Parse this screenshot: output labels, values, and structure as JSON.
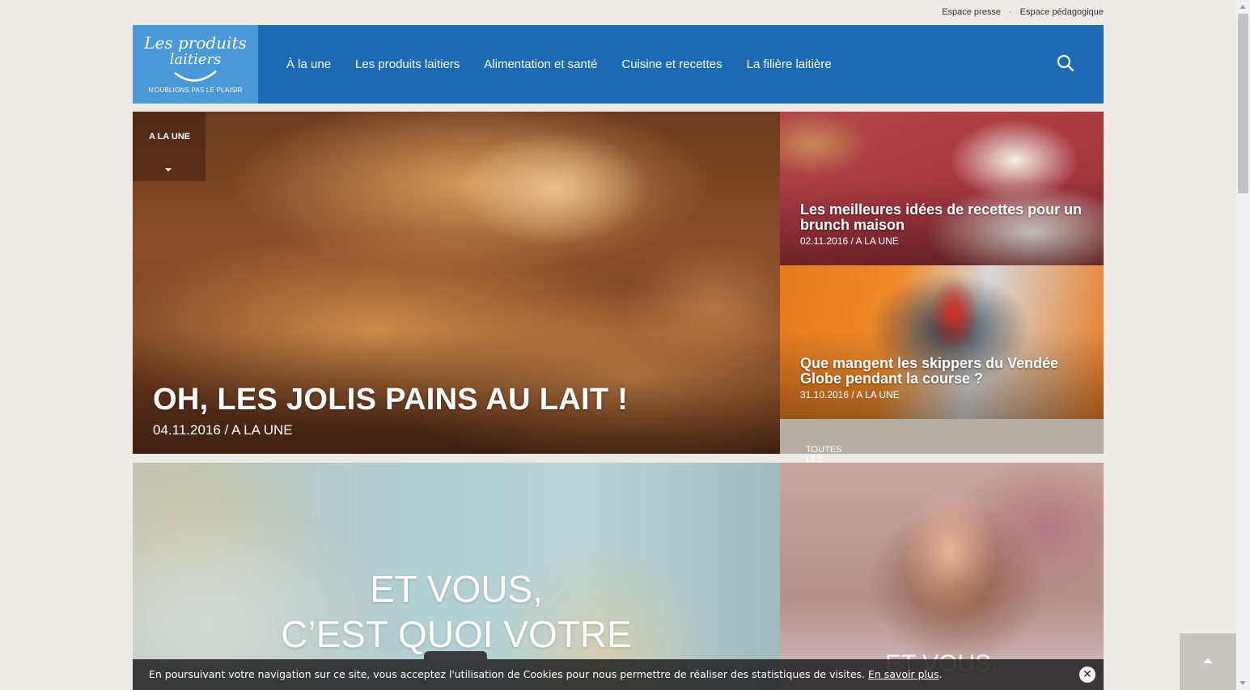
{
  "top_links": {
    "press": "Espace presse",
    "separator": "·",
    "education": "Espace pédagogique"
  },
  "logo": {
    "line1": "Les produits",
    "line2": "laitiers",
    "tagline": "N'OUBLIONS PAS LE PLAISIR"
  },
  "nav": {
    "items": [
      "À la une",
      "Les produits laitiers",
      "Alimentation et santé",
      "Cuisine et recettes",
      "La filière laitière"
    ],
    "search_icon": "search-icon"
  },
  "hero": {
    "badge": "A LA UNE",
    "title": "OH, LES JOLIS PAINS AU LAIT !",
    "meta": "04.11.2016 / A LA UNE"
  },
  "side_articles": [
    {
      "title": "Les meilleures idées de recettes pour un brunch maison",
      "meta": "02.11.2016 / A LA UNE"
    },
    {
      "title": "Que mangent les skippers du Vendée Globe pendant la course ?",
      "meta": "31.10.2016 / A LA UNE"
    }
  ],
  "all_news": {
    "label": "TOUTES LES ACTUALITÉS",
    "arrow": "→"
  },
  "bottom_left": {
    "line1": "ET VOUS,",
    "line2": "C’EST QUOI VOTRE"
  },
  "bottom_right": {
    "title": "ET VOUS,"
  },
  "cookie": {
    "text": "En poursuivant votre navigation sur ce site, vous acceptez l'utilisation de Cookies pour nous permettre de réaliser des statistiques de visites. ",
    "link": "En savoir plus",
    "end": ".",
    "close": "✕"
  },
  "colors": {
    "header_blue": "#1b6ab3",
    "logo_blue": "#4a98d8",
    "news_bar": "#b3ada3",
    "page_bg": "#eeebe6"
  }
}
